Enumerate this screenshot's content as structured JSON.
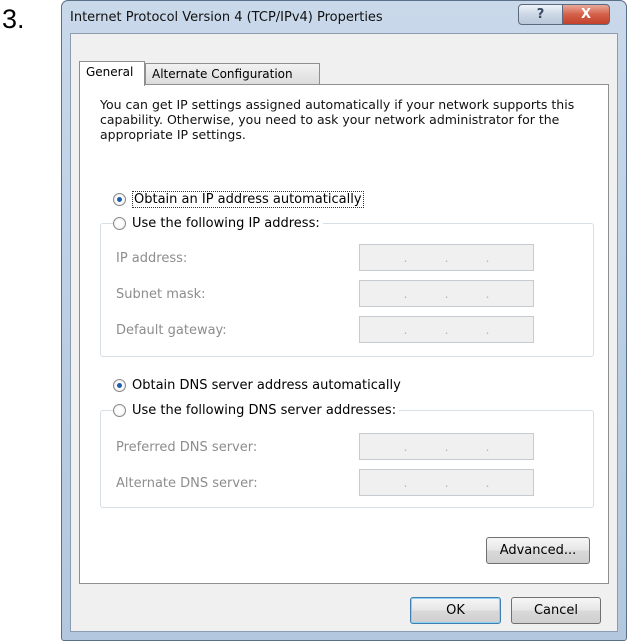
{
  "step_number": "3.",
  "window": {
    "title": "Internet Protocol Version 4 (TCP/IPv4) Properties",
    "help_label": "?",
    "close_label": "X"
  },
  "tabs": [
    {
      "label": "General",
      "active": true
    },
    {
      "label": "Alternate Configuration",
      "active": false
    }
  ],
  "intro_text": "You can get IP settings assigned automatically if your network supports this capability. Otherwise, you need to ask your network administrator for the appropriate IP settings.",
  "ip": {
    "auto_label": "Obtain an IP address automatically",
    "auto_selected": true,
    "manual_label": "Use the following IP address:",
    "fields": [
      {
        "label": "IP address:",
        "value": ". . ."
      },
      {
        "label": "Subnet mask:",
        "value": ". . ."
      },
      {
        "label": "Default gateway:",
        "value": ". . ."
      }
    ]
  },
  "dns": {
    "auto_label": "Obtain DNS server address automatically",
    "auto_selected": true,
    "manual_label": "Use the following DNS server addresses:",
    "fields": [
      {
        "label": "Preferred DNS server:",
        "value": ". . ."
      },
      {
        "label": "Alternate DNS server:",
        "value": ". . ."
      }
    ]
  },
  "buttons": {
    "advanced": "Advanced...",
    "ok": "OK",
    "cancel": "Cancel"
  },
  "colors": {
    "radio_dot": "#1f5fb2",
    "close_button": "#c2412a",
    "disabled_text": "#8d8d8d"
  }
}
